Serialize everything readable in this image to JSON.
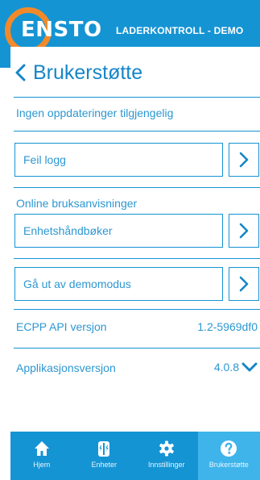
{
  "header": {
    "brand": "ENSTO",
    "app_title": "LADERKONTROLL - DEMO",
    "brand_color": "#1594d4",
    "logo_ring_color": "#f28a2a"
  },
  "page": {
    "back_icon": "chevron-left-icon",
    "title": "Brukerstøtte"
  },
  "updates_text": "Ingen oppdateringer tilgjengelig",
  "error_log": {
    "label": "Feil logg",
    "icon": "chevron-right-icon"
  },
  "manuals": {
    "section_label": "Online bruksanvisninger",
    "button_label": "Enhetshåndbøker",
    "icon": "chevron-right-icon"
  },
  "demo": {
    "label": "Gå ut av demomodus",
    "icon": "chevron-right-icon"
  },
  "api_version": {
    "label": "ECPP API versjon",
    "value": "1.2-5969df0"
  },
  "app_version": {
    "label": "Applikasjonsversjon",
    "value": "4.0.8",
    "icon": "chevron-down-icon"
  },
  "nav": {
    "items": [
      {
        "label": "Hjem",
        "icon": "home-icon",
        "active": false
      },
      {
        "label": "Enheter",
        "icon": "charger-icon",
        "active": false
      },
      {
        "label": "Innstillinger",
        "icon": "gear-icon",
        "active": false
      },
      {
        "label": "Brukerstøtte",
        "icon": "help-icon",
        "active": true
      }
    ]
  }
}
